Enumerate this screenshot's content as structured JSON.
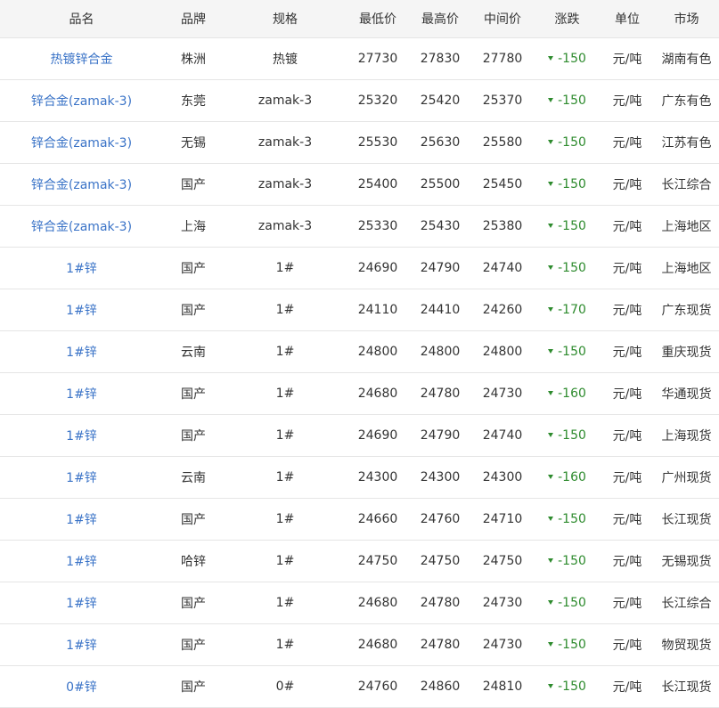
{
  "colors": {
    "link": "#3a73c7",
    "down": "#2e8b2e",
    "header_bg": "#f5f5f5",
    "border": "#e5e5e5"
  },
  "headers": [
    "品名",
    "品牌",
    "规格",
    "最低价",
    "最高价",
    "中间价",
    "涨跌",
    "单位",
    "市场"
  ],
  "change_icon": "down-triangle-icon",
  "rows": [
    {
      "name": "热镀锌合金",
      "brand": "株洲",
      "spec": "热镀",
      "low": "27730",
      "high": "27830",
      "mid": "27780",
      "change": "-150",
      "unit": "元/吨",
      "market": "湖南有色"
    },
    {
      "name": "锌合金(zamak-3)",
      "brand": "东莞",
      "spec": "zamak-3",
      "low": "25320",
      "high": "25420",
      "mid": "25370",
      "change": "-150",
      "unit": "元/吨",
      "market": "广东有色"
    },
    {
      "name": "锌合金(zamak-3)",
      "brand": "无锡",
      "spec": "zamak-3",
      "low": "25530",
      "high": "25630",
      "mid": "25580",
      "change": "-150",
      "unit": "元/吨",
      "market": "江苏有色"
    },
    {
      "name": "锌合金(zamak-3)",
      "brand": "国产",
      "spec": "zamak-3",
      "low": "25400",
      "high": "25500",
      "mid": "25450",
      "change": "-150",
      "unit": "元/吨",
      "market": "长江综合"
    },
    {
      "name": "锌合金(zamak-3)",
      "brand": "上海",
      "spec": "zamak-3",
      "low": "25330",
      "high": "25430",
      "mid": "25380",
      "change": "-150",
      "unit": "元/吨",
      "market": "上海地区"
    },
    {
      "name": "1#锌",
      "brand": "国产",
      "spec": "1#",
      "low": "24690",
      "high": "24790",
      "mid": "24740",
      "change": "-150",
      "unit": "元/吨",
      "market": "上海地区"
    },
    {
      "name": "1#锌",
      "brand": "国产",
      "spec": "1#",
      "low": "24110",
      "high": "24410",
      "mid": "24260",
      "change": "-170",
      "unit": "元/吨",
      "market": "广东现货"
    },
    {
      "name": "1#锌",
      "brand": "云南",
      "spec": "1#",
      "low": "24800",
      "high": "24800",
      "mid": "24800",
      "change": "-150",
      "unit": "元/吨",
      "market": "重庆现货"
    },
    {
      "name": "1#锌",
      "brand": "国产",
      "spec": "1#",
      "low": "24680",
      "high": "24780",
      "mid": "24730",
      "change": "-160",
      "unit": "元/吨",
      "market": "华通现货"
    },
    {
      "name": "1#锌",
      "brand": "国产",
      "spec": "1#",
      "low": "24690",
      "high": "24790",
      "mid": "24740",
      "change": "-150",
      "unit": "元/吨",
      "market": "上海现货"
    },
    {
      "name": "1#锌",
      "brand": "云南",
      "spec": "1#",
      "low": "24300",
      "high": "24300",
      "mid": "24300",
      "change": "-160",
      "unit": "元/吨",
      "market": "广州现货"
    },
    {
      "name": "1#锌",
      "brand": "国产",
      "spec": "1#",
      "low": "24660",
      "high": "24760",
      "mid": "24710",
      "change": "-150",
      "unit": "元/吨",
      "market": "长江现货"
    },
    {
      "name": "1#锌",
      "brand": "哈锌",
      "spec": "1#",
      "low": "24750",
      "high": "24750",
      "mid": "24750",
      "change": "-150",
      "unit": "元/吨",
      "market": "无锡现货"
    },
    {
      "name": "1#锌",
      "brand": "国产",
      "spec": "1#",
      "low": "24680",
      "high": "24780",
      "mid": "24730",
      "change": "-150",
      "unit": "元/吨",
      "market": "长江综合"
    },
    {
      "name": "1#锌",
      "brand": "国产",
      "spec": "1#",
      "low": "24680",
      "high": "24780",
      "mid": "24730",
      "change": "-150",
      "unit": "元/吨",
      "market": "物贸现货"
    },
    {
      "name": "0#锌",
      "brand": "国产",
      "spec": "0#",
      "low": "24760",
      "high": "24860",
      "mid": "24810",
      "change": "-150",
      "unit": "元/吨",
      "market": "长江现货"
    }
  ]
}
